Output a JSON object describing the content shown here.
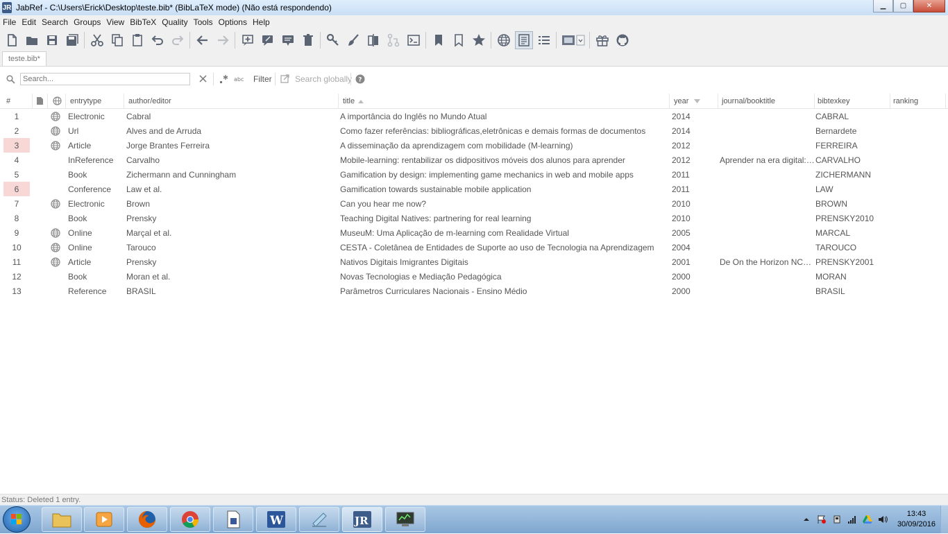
{
  "window": {
    "title": "JabRef - C:\\Users\\Erick\\Desktop\\teste.bib* (BibLaTeX mode) (Não está respondendo)",
    "logo_text": "JR"
  },
  "menu": [
    "File",
    "Edit",
    "Search",
    "Groups",
    "View",
    "BibTeX",
    "Quality",
    "Tools",
    "Options",
    "Help"
  ],
  "tab": {
    "label": "teste.bib*"
  },
  "search": {
    "placeholder": "Search...",
    "filter_label": "Filter",
    "search_globally_label": "Search globally"
  },
  "columns": {
    "num": "#",
    "entrytype": "entrytype",
    "author": "author/editor",
    "title": "title",
    "year": "year",
    "journal": "journal/booktitle",
    "bibtexkey": "bibtexkey",
    "ranking": "ranking"
  },
  "entries": [
    {
      "num": "1",
      "highlight": false,
      "url": true,
      "entrytype": "Electronic",
      "author": "Cabral",
      "title": "A importância do Inglês no Mundo Atual",
      "year": "2014",
      "journal": "",
      "bibtexkey": "CABRAL"
    },
    {
      "num": "2",
      "highlight": false,
      "url": true,
      "entrytype": "Url",
      "author": "Alves and de Arruda",
      "title": "Como fazer referências: bibliográficas,eletrônicas e demais formas de documentos",
      "year": "2014",
      "journal": "",
      "bibtexkey": "Bernardete"
    },
    {
      "num": "3",
      "highlight": true,
      "url": true,
      "entrytype": "Article",
      "author": "Jorge Brantes Ferreira",
      "title": "A disseminação da aprendizagem com mobilidade (M-learning)",
      "year": "2012",
      "journal": "",
      "bibtexkey": "FERREIRA"
    },
    {
      "num": "4",
      "highlight": false,
      "url": false,
      "entrytype": "InReference",
      "author": "Carvalho",
      "title": "Mobile-learning: rentabilizar os didpositivos móveis dos alunos para aprender",
      "year": "2012",
      "journal": "Aprender na era digital:…",
      "bibtexkey": "CARVALHO"
    },
    {
      "num": "5",
      "highlight": false,
      "url": false,
      "entrytype": "Book",
      "author": "Zichermann and Cunningham",
      "title": "Gamification by design: implementing game mechanics in web and mobile apps",
      "year": "2011",
      "journal": "",
      "bibtexkey": "ZICHERMANN"
    },
    {
      "num": "6",
      "highlight": true,
      "url": false,
      "entrytype": "Conference",
      "author": "Law et al.",
      "title": "Gamification towards sustainable mobile application",
      "year": "2011",
      "journal": "",
      "bibtexkey": "LAW"
    },
    {
      "num": "7",
      "highlight": false,
      "url": true,
      "entrytype": "Electronic",
      "author": "Brown",
      "title": "Can you hear me now?",
      "year": "2010",
      "journal": "",
      "bibtexkey": "BROWN"
    },
    {
      "num": "8",
      "highlight": false,
      "url": false,
      "entrytype": "Book",
      "author": "Prensky",
      "title": "Teaching Digital Natives: partnering for real learning",
      "year": "2010",
      "journal": "",
      "bibtexkey": "PRENSKY2010"
    },
    {
      "num": "9",
      "highlight": false,
      "url": true,
      "entrytype": "Online",
      "author": "Marçal et al.",
      "title": "MuseuM: Uma Aplicação de m-learning com Realidade Virtual",
      "year": "2005",
      "journal": "",
      "bibtexkey": "MARCAL"
    },
    {
      "num": "10",
      "highlight": false,
      "url": true,
      "entrytype": "Online",
      "author": "Tarouco",
      "title": "CESTA - Coletânea de Entidades de Suporte ao uso de Tecnologia na Aprendizagem",
      "year": "2004",
      "journal": "",
      "bibtexkey": "TAROUCO"
    },
    {
      "num": "11",
      "highlight": false,
      "url": true,
      "entrytype": "Article",
      "author": "Prensky",
      "title": "Nativos Digitais Imigrantes Digitais",
      "year": "2001",
      "journal": "De On the Horizon NC…",
      "bibtexkey": "PRENSKY2001"
    },
    {
      "num": "12",
      "highlight": false,
      "url": false,
      "entrytype": "Book",
      "author": "Moran et al.",
      "title": "Novas Tecnologias e Mediação Pedagógica",
      "year": "2000",
      "journal": "",
      "bibtexkey": "MORAN"
    },
    {
      "num": "13",
      "highlight": false,
      "url": false,
      "entrytype": "Reference",
      "author": "BRASIL",
      "title": "Parâmetros Curriculares Nacionais - Ensino Médio",
      "year": "2000",
      "journal": "",
      "bibtexkey": "BRASIL"
    }
  ],
  "status": {
    "text": "Status: Deleted 1 entry."
  },
  "taskbar": {
    "time": "13:43",
    "date": "30/09/2016",
    "word_label": "W",
    "jabref_label": "JR"
  },
  "colors": {
    "highlight_row": "#f8d7d7",
    "toolbar_icon": "#5a6473",
    "title_gradient_top": "#dfeefc"
  }
}
